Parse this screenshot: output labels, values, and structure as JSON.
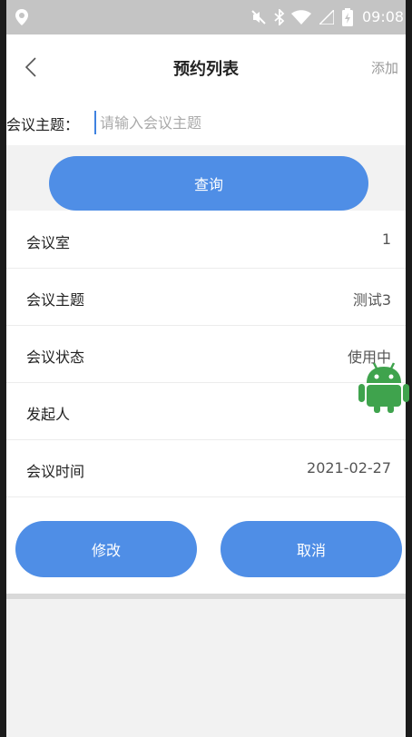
{
  "status_bar": {
    "time": "09:08"
  },
  "nav": {
    "title": "预约列表",
    "add_label": "添加"
  },
  "search": {
    "label": "会议主题：",
    "placeholder": "请输入会议主题"
  },
  "query_label": "查询",
  "details": [
    {
      "key": "会议室",
      "value": "1"
    },
    {
      "key": "会议主题",
      "value": "测试3"
    },
    {
      "key": "会议状态",
      "value": "使用中"
    },
    {
      "key": "发起人",
      "value": ""
    },
    {
      "key": "会议时间",
      "value": "2021-02-27"
    }
  ],
  "actions": {
    "edit_label": "修改",
    "cancel_label": "取消"
  },
  "colors": {
    "accent": "#4f8ee6",
    "status_bar": "#c4c4c4",
    "android_green": "#3fa34d"
  },
  "icons": {
    "back": "chevron-left-icon",
    "android": "android-robot-icon"
  }
}
